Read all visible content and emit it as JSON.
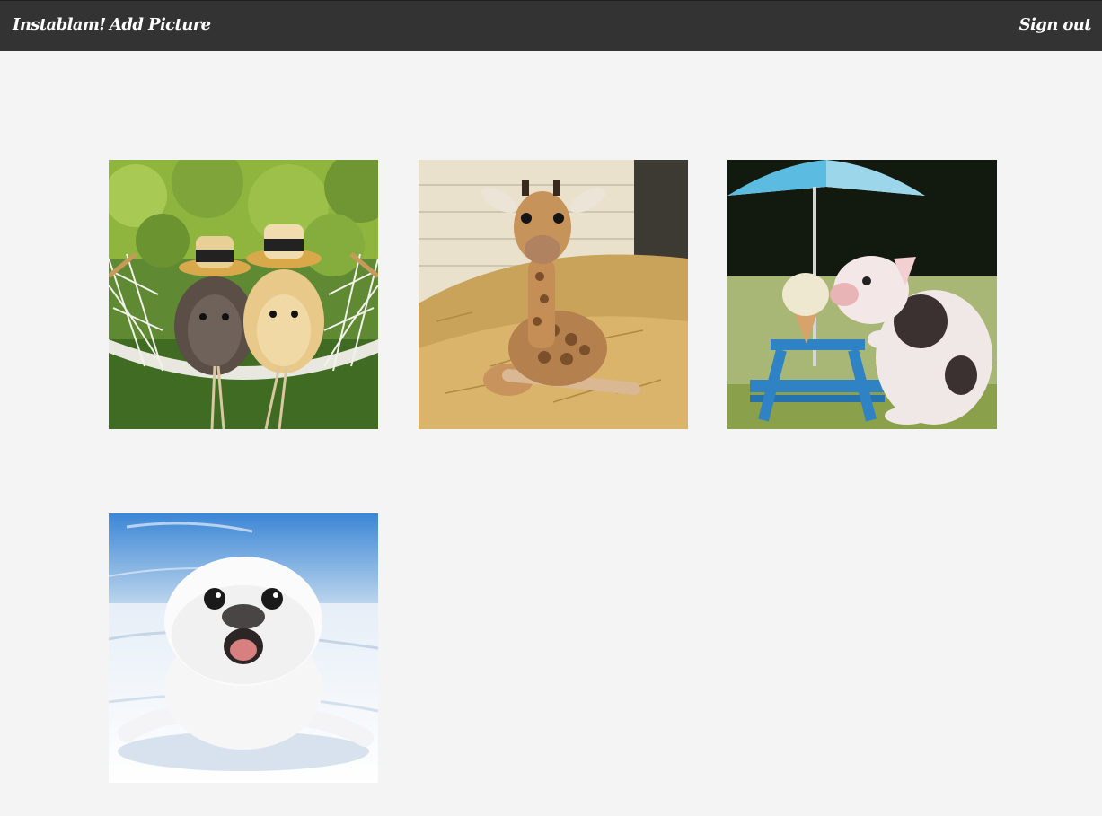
{
  "navbar": {
    "brand": "Instablam!",
    "add_picture": "Add Picture",
    "sign_out": "Sign out",
    "background": "#333333"
  },
  "gallery": {
    "pictures": [
      {
        "subject": "two guinea pigs in straw hats on a hammock"
      },
      {
        "subject": "baby giraffe sitting on straw"
      },
      {
        "subject": "piglet with ice cream at a blue picnic table"
      },
      {
        "subject": "smiling baby seal on snow"
      }
    ]
  },
  "colors": {
    "page_background": "#f4f4f4",
    "nav_text": "#ffffff"
  }
}
